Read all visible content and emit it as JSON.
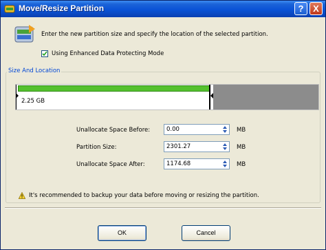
{
  "window": {
    "title": "Move/Resize Partition",
    "help_label": "?",
    "close_label": "X"
  },
  "intro_text": "Enter the new partition size and specify the location of the selected partition.",
  "enhanced_mode": {
    "label": "Using Enhanced Data Protecting Mode",
    "checked": true
  },
  "group": {
    "legend": "Size And Location"
  },
  "partition_bar": {
    "size_label": "2.25 GB"
  },
  "fields": [
    {
      "label": "Unallocate Space Before:",
      "value": "0.00",
      "unit": "MB"
    },
    {
      "label": "Partition Size:",
      "value": "2301.27",
      "unit": "MB"
    },
    {
      "label": "Unallocate Space After:",
      "value": "1174.68",
      "unit": "MB"
    }
  ],
  "warning_text": "It's recommended to backup your data before moving or resizing the partition.",
  "buttons": {
    "ok": "OK",
    "cancel": "Cancel"
  },
  "colors": {
    "title_bar": "#0a53d6",
    "used_space": "#55c12f",
    "unallocated": "#8c8c8c",
    "legend_text": "#0046d5"
  },
  "icons": [
    "partition-app-icon",
    "help-icon",
    "close-icon",
    "partition-disk-icon",
    "check-icon",
    "warning-icon"
  ]
}
